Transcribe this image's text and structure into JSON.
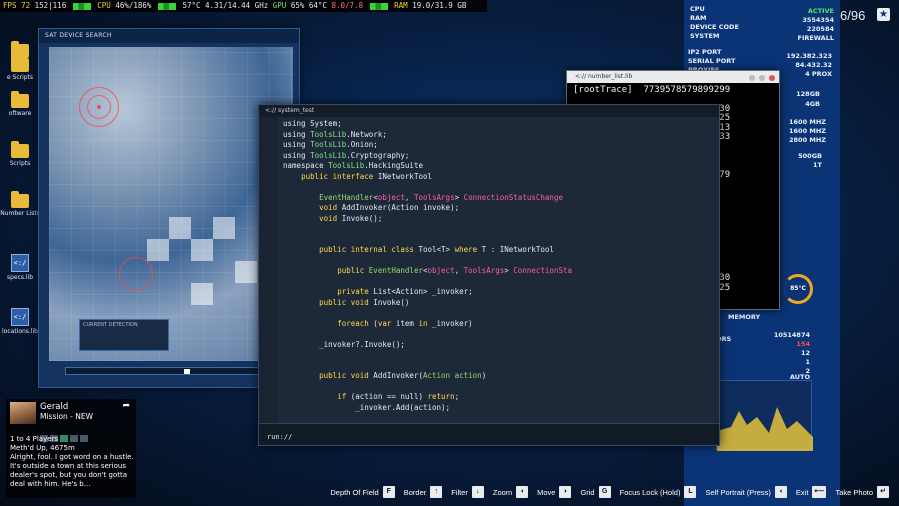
{
  "perf_overlay": {
    "fps_label": "FPS",
    "fps_value": "72",
    "fps_detail": "152|116",
    "cpu_label": "CPU",
    "cpu_value": "46%/186%",
    "cpu_temp": "57°C",
    "cpu_clock": "4.31/14.44 GHz",
    "gpu_label": "GPU",
    "gpu_value": "65%",
    "gpu_temp": "64°C",
    "gpu_mem": "8.0/7.8",
    "ram_label": "RAM",
    "ram_value": "19.0/31.9 GB"
  },
  "desktop_icons": [
    {
      "label": "",
      "type": "folder"
    },
    {
      "label": "e Scripts",
      "type": "folder"
    },
    {
      "label": "oftware",
      "type": "folder"
    },
    {
      "label": "Scripts",
      "type": "folder"
    },
    {
      "label": "Number Lists",
      "type": "folder"
    },
    {
      "label": "specs.lib",
      "type": "file",
      "glyph": "<:/"
    },
    {
      "label": "locations.lib",
      "type": "file",
      "glyph": "<:/"
    }
  ],
  "map_window": {
    "title": "SAT DEVICE SEARCH",
    "panel_label": "CURRENT DETECTION"
  },
  "code_window": {
    "title": "<:// system_test",
    "prompt": "run://",
    "lines": [
      "using System;",
      "using ToolsLib.Network;",
      "using ToolsLib.Onion;",
      "using ToolsLib.Cryptography;",
      "namespace ToolsLib.HackingSuite",
      "    public interface INetworkTool",
      "",
      "        EventHandler<object, ToolsArgs> ConnectionStatusChange",
      "        void AddInvoker(Action invoke);",
      "        void Invoke();",
      "",
      "",
      "        public internal class Tool<T> where T : INetworkTool",
      "",
      "            public EventHandler<object, ToolsArgs> ConnectionSta",
      "",
      "            private List<Action> _invoker;",
      "        public void Invoke()",
      "",
      "            foreach (var item in _invoker)",
      "",
      "        _invoker?.Invoke();",
      "",
      "",
      "        public void AddInvoker(Action action)",
      "",
      "            if (action == null) return;",
      "                _invoker.Add(action);",
      "",
      "        _invoker?.Invoke();"
    ]
  },
  "terminal_window": {
    "title": "<:// number_list.lib",
    "lines": [
      "[rootTrace]  7739578579899299",
      "",
      "[rootTrace]  5226157735941630",
      "[rootTrace]  2457317836260225",
      "[rootTrace]  8034769060346313",
      "[rootTrace]  7195797891915833",
      "",
      "[common]  3575812043997297",
      "[common]  9160930392253770",
      "[common]  9531364360323603279",
      "[common]  4421345289397867",
      "[common]  5671366394356972",
      "[common]  2885992939671230",
      "",
      "[common]  9531364360323679",
      "[common]  4421345289397867",
      "",
      "[Trace]  5047633147773696",
      "[Trace]  7739578579899299",
      "",
      "[rootTrace]  5226157735941630",
      "[rootTrace]  2457317836260225",
      "[Trace]  9473586012870080",
      "[Trace]  6492136098",
      "[Trace]  7498675320812891",
      "[Trace]  7498675320832533",
      "[Trace]  5320301952589802",
      "[Trace]  5326804773780156"
    ]
  },
  "stats_panel": {
    "labels": [
      "CPU",
      "RAM",
      "DEVICE CODE",
      "SYSTEM",
      "IP2 PORT",
      "SERIAL PORT",
      "PROXIES"
    ],
    "values": [
      "ACTIVE",
      "3554354",
      "220584",
      "FIREWALL",
      "192.382.323",
      "84.432.32",
      "4 PROX"
    ],
    "specs": [
      "128GB",
      "4GB",
      "1600 MHZ",
      "1600 MHZ",
      "2800 MHZ",
      "500GB",
      "1T"
    ],
    "gauge": "85°C",
    "memory_label": "MEMORY",
    "memory_values": [
      "10514874",
      "154",
      "12",
      "1",
      "2",
      "AUTO"
    ],
    "row_label": "ORS"
  },
  "counter": {
    "value": "6/96",
    "icon": "star-icon"
  },
  "mission_card": {
    "name": "Gerald",
    "subtitle": "Mission - NEW",
    "players": "1 to 4 Players",
    "mission_title": "Meth'd Up, 4675m",
    "description": "Alright, fool. I got word on a hustle. It's outside a town at this serious dealer's spot, but you don't gotta deal with him. He's b..."
  },
  "controls": [
    {
      "label": "Depth Of Field",
      "key": "F"
    },
    {
      "label": "Border",
      "key": "↑"
    },
    {
      "label": "Filter",
      "key": "↓"
    },
    {
      "label": "Zoom",
      "key": "◖"
    },
    {
      "label": "Move",
      "key": "◗"
    },
    {
      "label": "Grid",
      "key": "G"
    },
    {
      "label": "Focus Lock (Hold)",
      "key": "L"
    },
    {
      "label": "Self Portrait (Press)",
      "key": "◖"
    },
    {
      "label": "Exit",
      "key": "⟵"
    },
    {
      "label": "Take Photo",
      "key": "↵"
    }
  ],
  "colors": {
    "accent_blue": "#0b3476",
    "active_green": "#55e36b",
    "alert_red": "#ff4d4d",
    "keyword_yellow": "#ffd84a",
    "type_green": "#7fe38a",
    "param_pink": "#ff5da8"
  }
}
